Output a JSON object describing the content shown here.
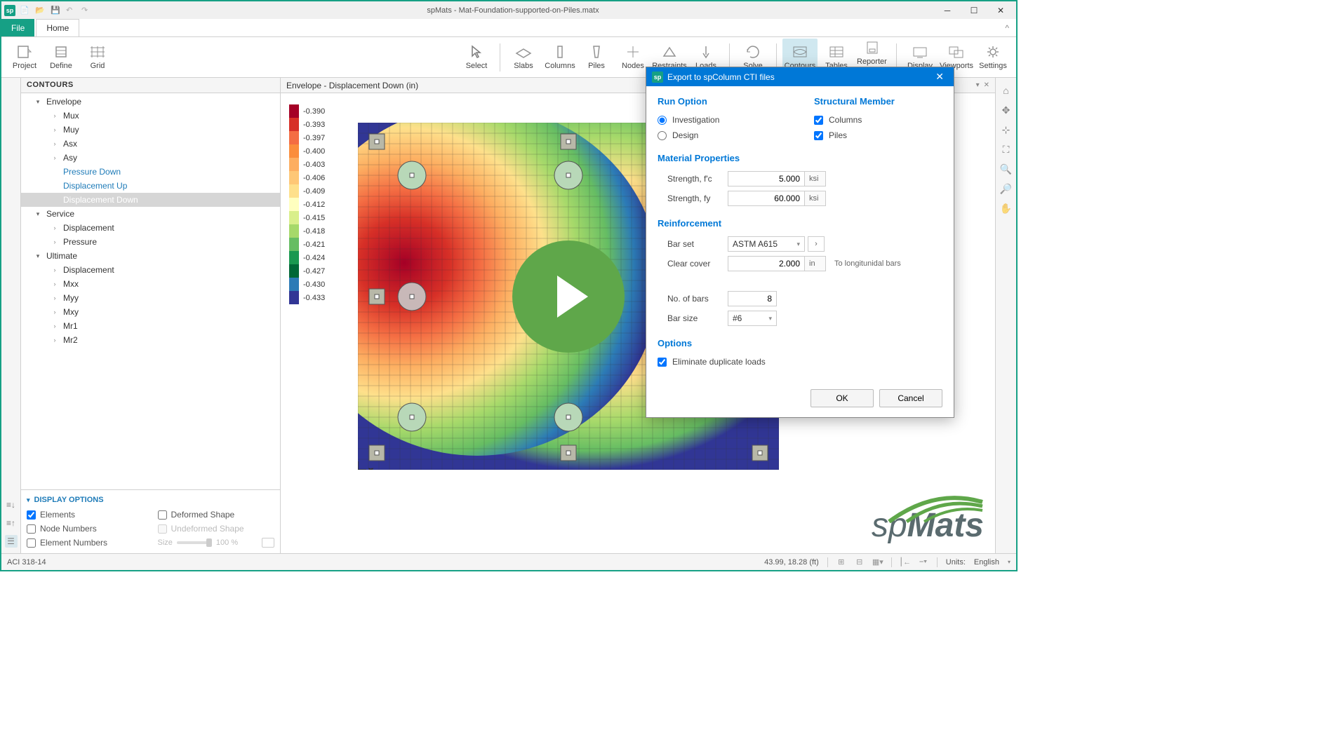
{
  "window_title": "spMats - Mat-Foundation-supported-on-Piles.matx",
  "app_icon_label": "sp",
  "qat": [
    "new",
    "open",
    "save",
    "undo",
    "redo"
  ],
  "menu": {
    "file": "File",
    "home": "Home"
  },
  "ribbon": {
    "left_group": [
      {
        "label": "Project",
        "icon": "project"
      },
      {
        "label": "Define",
        "icon": "define"
      },
      {
        "label": "Grid",
        "icon": "grid"
      }
    ],
    "mid_group": [
      {
        "label": "Select",
        "icon": "cursor"
      }
    ],
    "tools_group": [
      {
        "label": "Slabs",
        "icon": "slab"
      },
      {
        "label": "Columns",
        "icon": "column"
      },
      {
        "label": "Piles",
        "icon": "pile"
      },
      {
        "label": "Nodes",
        "icon": "node"
      },
      {
        "label": "Restraints",
        "icon": "restraint"
      },
      {
        "label": "Loads",
        "icon": "load"
      }
    ],
    "solve_group": [
      {
        "label": "Solve",
        "icon": "solve"
      }
    ],
    "view_group": [
      {
        "label": "Contours",
        "icon": "contours",
        "active": true
      },
      {
        "label": "Tables",
        "icon": "tables"
      },
      {
        "label": "Reporter",
        "icon": "reporter",
        "dropdown": true
      }
    ],
    "right_group": [
      {
        "label": "Display",
        "icon": "display"
      },
      {
        "label": "Viewports",
        "icon": "viewports"
      },
      {
        "label": "Settings",
        "icon": "settings"
      }
    ]
  },
  "contours_panel": {
    "title": "CONTOURS",
    "tree": [
      {
        "label": "Envelope",
        "level": 0,
        "expanded": true
      },
      {
        "label": "Mux",
        "level": 1,
        "sub": true
      },
      {
        "label": "Muy",
        "level": 1,
        "sub": true
      },
      {
        "label": "Asx",
        "level": 1,
        "sub": true
      },
      {
        "label": "Asy",
        "level": 1,
        "sub": true
      },
      {
        "label": "Pressure Down",
        "level": 1,
        "blue": true
      },
      {
        "label": "Displacement Up",
        "level": 1,
        "blue": true
      },
      {
        "label": "Displacement Down",
        "level": 1,
        "selected": true
      },
      {
        "label": "Service",
        "level": 0,
        "expanded": true
      },
      {
        "label": "Displacement",
        "level": 1,
        "sub": true
      },
      {
        "label": "Pressure",
        "level": 1,
        "sub": true
      },
      {
        "label": "Ultimate",
        "level": 0,
        "expanded": true
      },
      {
        "label": "Displacement",
        "level": 1,
        "sub": true
      },
      {
        "label": "Mxx",
        "level": 1,
        "sub": true
      },
      {
        "label": "Myy",
        "level": 1,
        "sub": true
      },
      {
        "label": "Mxy",
        "level": 1,
        "sub": true
      },
      {
        "label": "Mr1",
        "level": 1,
        "sub": true
      },
      {
        "label": "Mr2",
        "level": 1,
        "sub": true
      }
    ]
  },
  "display_options": {
    "title": "DISPLAY OPTIONS",
    "items": [
      {
        "label": "Elements",
        "checked": true
      },
      {
        "label": "Deformed Shape",
        "checked": false
      },
      {
        "label": "Node Numbers",
        "checked": false
      },
      {
        "label": "Undeformed Shape",
        "checked": false,
        "disabled": true
      },
      {
        "label": "Element Numbers",
        "checked": false
      }
    ],
    "slider_label": "Size",
    "slider_value": "100 %"
  },
  "viewport": {
    "title": "Envelope - Displacement Down (in)"
  },
  "legend": {
    "values": [
      "-0.390",
      "-0.393",
      "-0.397",
      "-0.400",
      "-0.403",
      "-0.406",
      "-0.409",
      "-0.412",
      "-0.415",
      "-0.418",
      "-0.421",
      "-0.424",
      "-0.427",
      "-0.430",
      "-0.433"
    ],
    "colors": [
      "#a50026",
      "#d73027",
      "#f46d43",
      "#fb8d3c",
      "#fdae61",
      "#fec776",
      "#fee08b",
      "#ffffbf",
      "#d9ef8b",
      "#a6d96a",
      "#66bd63",
      "#1a9850",
      "#006837",
      "#2c7bb6",
      "#313695"
    ]
  },
  "right_tools": [
    "home",
    "move",
    "crosshair",
    "zoom-extents",
    "zoom-in",
    "zoom",
    "pan"
  ],
  "dialog": {
    "title": "Export to spColumn CTI files",
    "run_option": {
      "title": "Run Option",
      "options": [
        {
          "label": "Investigation",
          "checked": true
        },
        {
          "label": "Design",
          "checked": false
        }
      ]
    },
    "structural_member": {
      "title": "Structural Member",
      "options": [
        {
          "label": "Columns",
          "checked": true
        },
        {
          "label": "Piles",
          "checked": true
        }
      ]
    },
    "material": {
      "title": "Material Properties",
      "fc_label": "Strength, f'c",
      "fc_value": "5.000",
      "fc_unit": "ksi",
      "fy_label": "Strength, fy",
      "fy_value": "60.000",
      "fy_unit": "ksi"
    },
    "reinforcement": {
      "title": "Reinforcement",
      "barset_label": "Bar set",
      "barset_value": "ASTM A615",
      "cover_label": "Clear cover",
      "cover_value": "2.000",
      "cover_unit": "in",
      "cover_note": "To longitunidal bars",
      "bars_label": "No. of bars",
      "bars_value": "8",
      "size_label": "Bar size",
      "size_value": "#6"
    },
    "options": {
      "title": "Options",
      "eliminate_label": "Eliminate duplicate loads",
      "eliminate_checked": true
    },
    "ok": "OK",
    "cancel": "Cancel"
  },
  "status": {
    "code": "ACI 318-14",
    "coords": "43.99, 18.28 (ft)",
    "units_label": "Units:",
    "units_value": "English"
  },
  "logo": {
    "sp": "sp",
    "mats": "Mats"
  }
}
